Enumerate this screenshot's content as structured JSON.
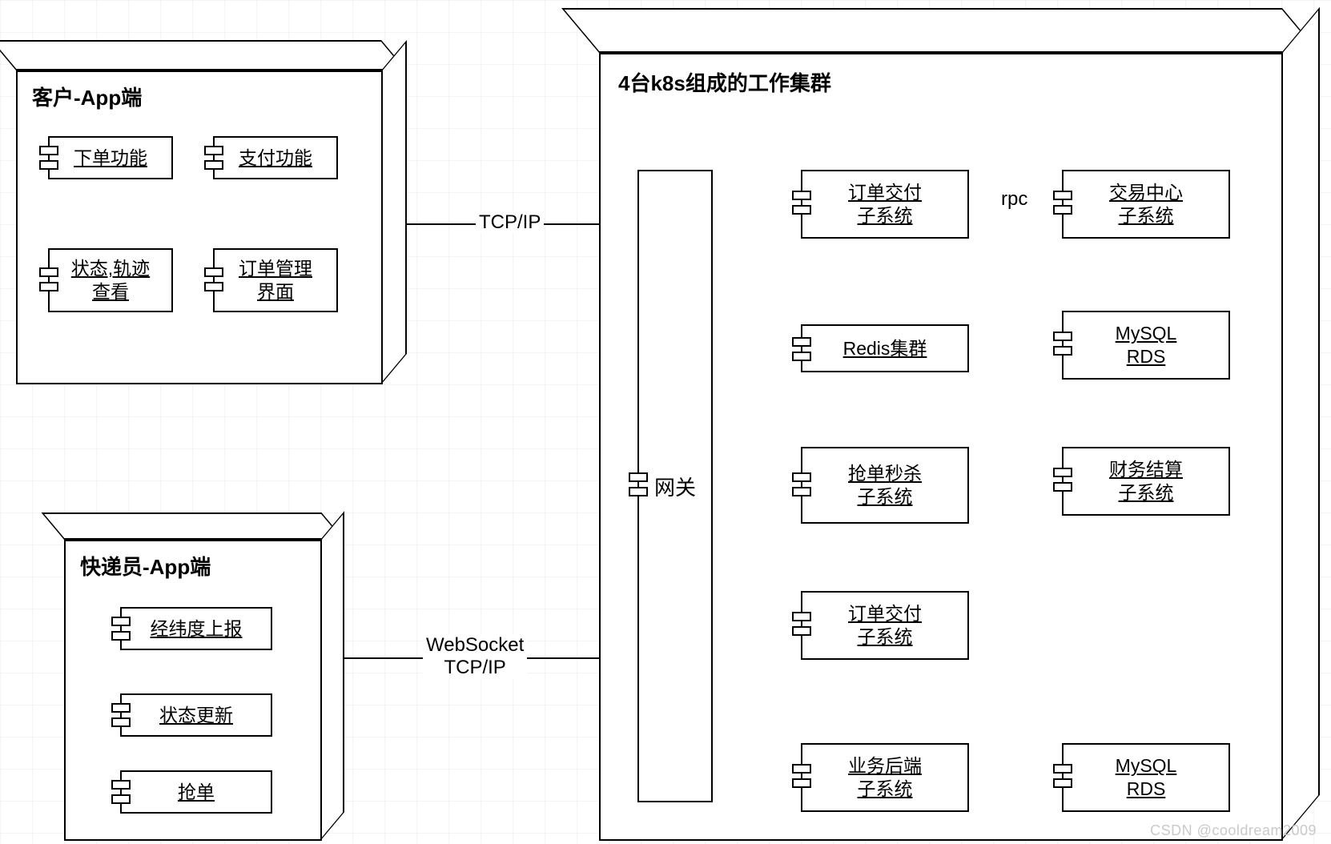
{
  "watermark": "CSDN @cooldream2009",
  "containers": {
    "customer": {
      "title": "客户-App端"
    },
    "courier": {
      "title": "快递员-App端"
    },
    "cluster": {
      "title": "4台k8s组成的工作集群"
    }
  },
  "components": {
    "c_order": "下单功能",
    "c_pay": "支付功能",
    "c_status": "状态,轨迹\n查看",
    "c_order_mgmt": "订单管理\n界面",
    "k_geo": "经纬度上报",
    "k_status": "状态更新",
    "k_grab": "抢单",
    "gateway": "网关",
    "s_deliver1": "订单交付\n子系统",
    "s_trade": "交易中心\n子系统",
    "s_redis": "Redis集群",
    "s_mysql1": "MySQL\nRDS",
    "s_seckill": "抢单秒杀\n子系统",
    "s_fin": "财务结算\n子系统",
    "s_deliver2": "订单交付\n子系统",
    "s_bizback": "业务后端\n子系统",
    "s_mysql2": "MySQL\nRDS"
  },
  "edge_labels": {
    "tcp": "TCP/IP",
    "ws": "WebSocket\nTCP/IP",
    "rpc": "rpc"
  }
}
